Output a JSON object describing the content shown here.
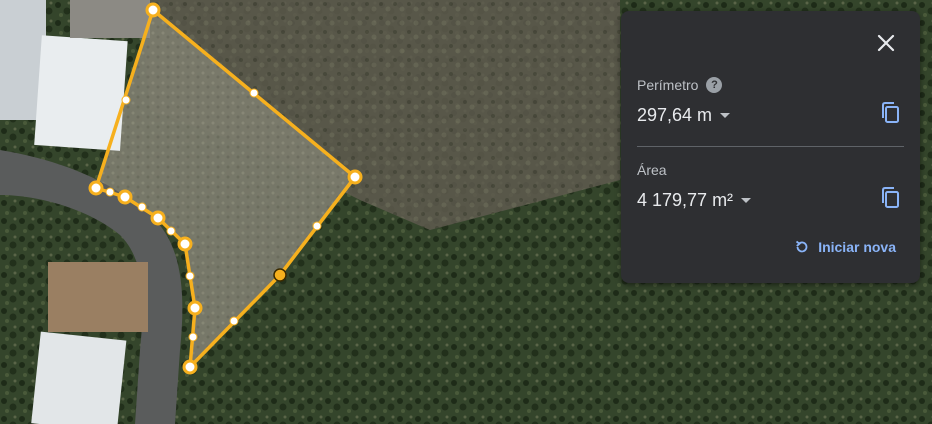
{
  "panel": {
    "perimeter_label": "Perímetro",
    "perimeter_value": "297,64 m",
    "area_label": "Área",
    "area_value": "4 179,77 m²",
    "restart_label": "Iniciar nova"
  },
  "icons": {
    "close": "close-icon",
    "help": "help-icon",
    "copy": "copy-icon",
    "restart": "refresh-icon",
    "dropdown": "caret-down-icon"
  },
  "colors": {
    "measure_line": "#f6b01e",
    "vertex_fill": "#ffffff",
    "link": "#8ab4f8",
    "panel_bg": "#2e2f32"
  }
}
